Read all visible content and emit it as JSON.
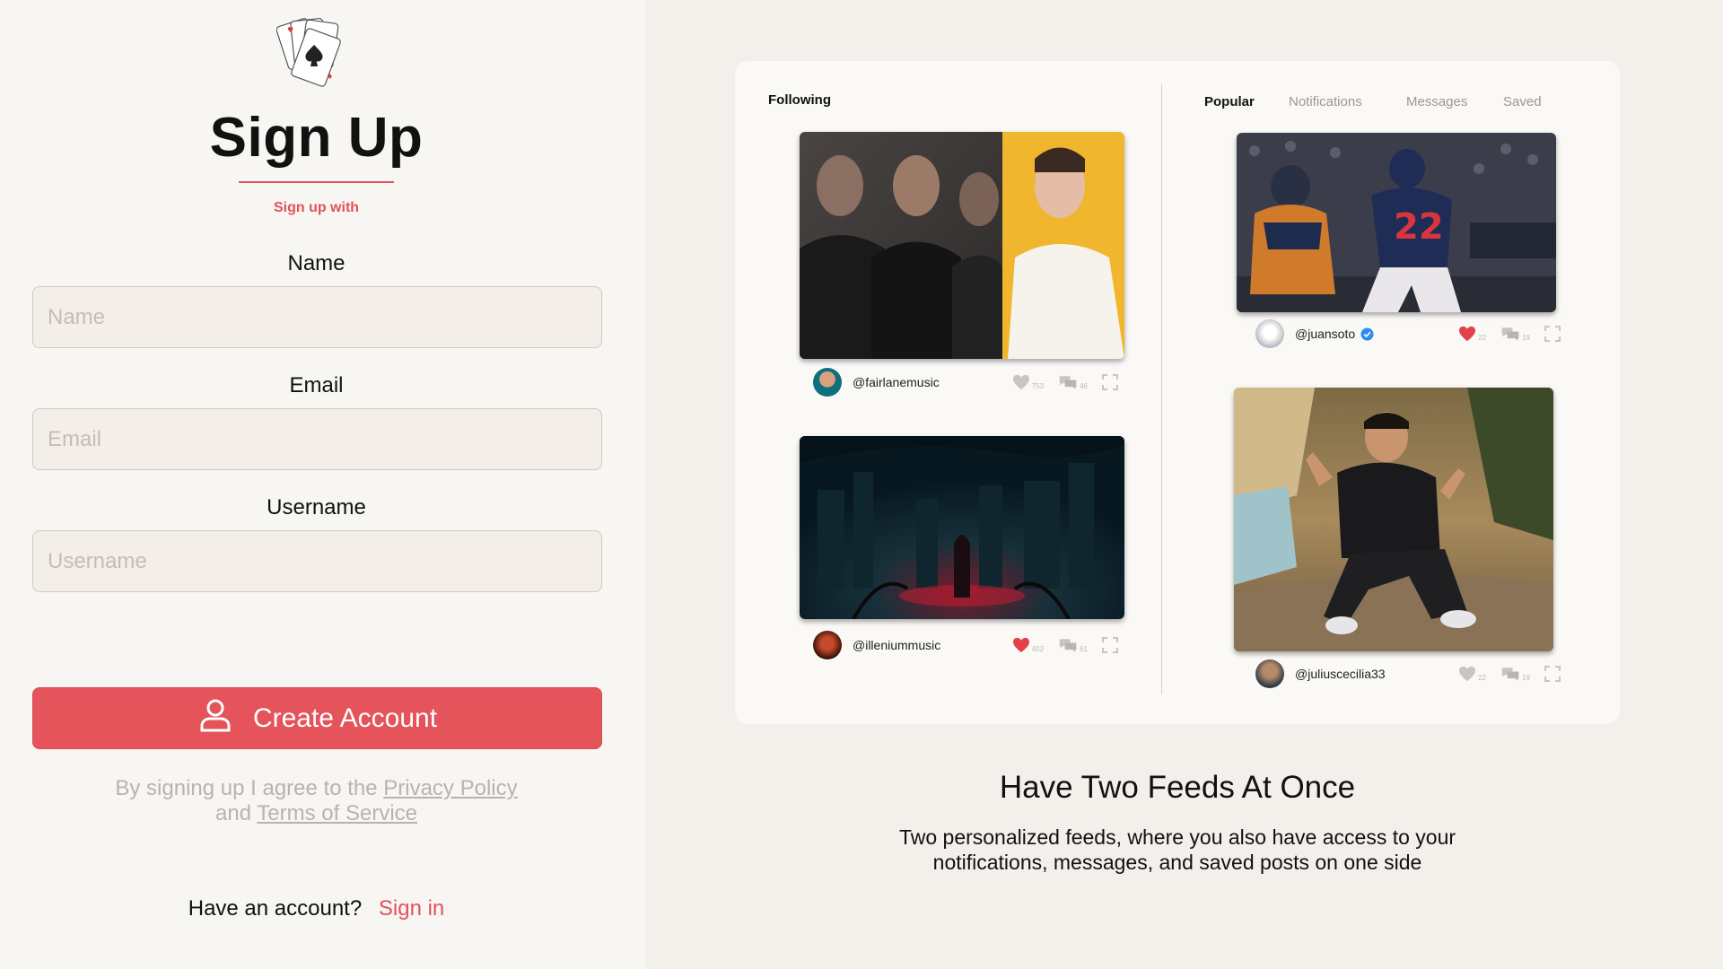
{
  "brand": {
    "logo_icon": "playing-cards-icon",
    "accent": "#e5535b"
  },
  "signup": {
    "title": "Sign Up",
    "subtitle": "Sign up with",
    "fields": {
      "name": {
        "label": "Name",
        "placeholder": "Name",
        "value": ""
      },
      "email": {
        "label": "Email",
        "placeholder": "Email",
        "value": ""
      },
      "username": {
        "label": "Username",
        "placeholder": "Username",
        "value": ""
      }
    },
    "create_button": {
      "label": "Create Account",
      "icon": "user-icon"
    },
    "agreement": {
      "prefix": "By signing up I agree to the",
      "privacy_link": "Privacy Policy",
      "middle": "and",
      "terms_link": "Terms of Service"
    },
    "signin": {
      "prompt": "Have an account?",
      "link": "Sign in"
    }
  },
  "preview": {
    "left_feed": {
      "tab": "Following",
      "posts": [
        {
          "handle": "@fairlanemusic",
          "likes": "753",
          "comments": "46",
          "liked": false,
          "verified": false
        },
        {
          "handle": "@illeniummusic",
          "likes": "402",
          "comments": "61",
          "liked": true,
          "verified": false
        }
      ]
    },
    "right_feed": {
      "tabs": [
        "Popular",
        "Notifications",
        "Messages",
        "Saved"
      ],
      "active_tab": "Popular",
      "posts": [
        {
          "handle": "@juansoto",
          "likes": "22",
          "comments": "19",
          "liked": true,
          "verified": true
        },
        {
          "handle": "@juliuscecilia33",
          "likes": "22",
          "comments": "19",
          "liked": false,
          "verified": false
        }
      ]
    }
  },
  "feature": {
    "title": "Have Two Feeds At Once",
    "description": "Two personalized feeds, where you also have access to your notifications, messages, and saved posts on one side"
  }
}
